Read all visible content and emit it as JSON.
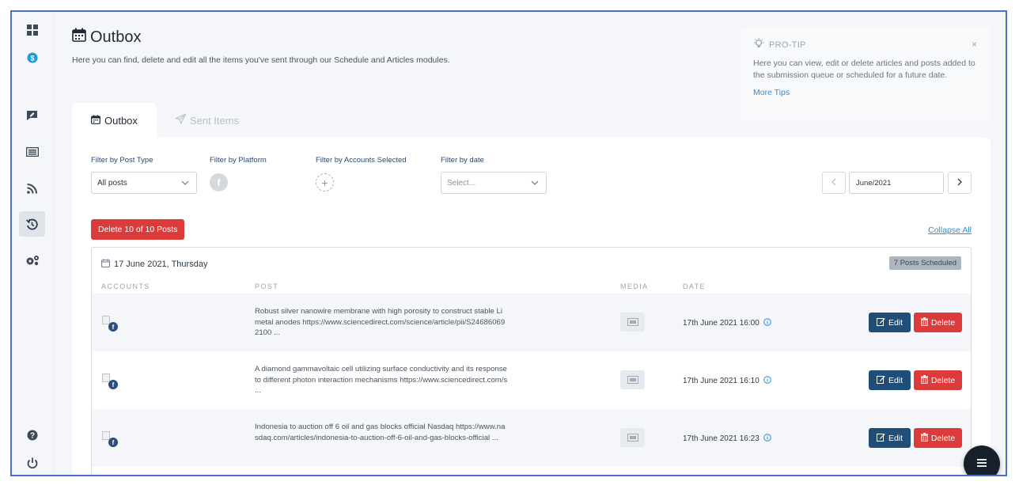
{
  "header": {
    "title": "Outbox",
    "description": "Here you can find, delete and edit all the items you've sent through our Schedule and Articles modules."
  },
  "protip": {
    "heading": "PRO-TIP",
    "close": "×",
    "text": "Here you can view, edit or delete articles and posts added to the submission queue or scheduled for a future date.",
    "link": "More Tips"
  },
  "tabs": [
    {
      "label": "Outbox",
      "active": true
    },
    {
      "label": "Sent Items",
      "active": false
    }
  ],
  "filters": {
    "post_type_label": "Filter by Post Type",
    "post_type_value": "All posts",
    "platform_label": "Filter by Platform",
    "platform_icon": "f",
    "accounts_label": "Filter by Accounts Selected",
    "accounts_add": "+",
    "date_label": "Filter by date",
    "date_placeholder": "Select...",
    "month_value": "June/2021"
  },
  "actions": {
    "delete_all": "Delete 10 of 10 Posts",
    "collapse_all": "Collapse All"
  },
  "group": {
    "date": "17 June 2021, Thursday",
    "badge": "7 Posts Scheduled",
    "columns": [
      "ACCOUNTS",
      "POST",
      "MEDIA",
      "DATE"
    ]
  },
  "rows": [
    {
      "post": "Robust silver nanowire membrane with high porosity to construct stable Li metal anodes https://www.sciencedirect.com/science/article/pii/S246860692100 ...",
      "date": "17th June 2021 16:00",
      "edit": "Edit",
      "delete": "Delete"
    },
    {
      "post": "A diamond gammavoltaic cell utilizing surface conductivity and its response to different photon interaction mechanisms https://www.sciencedirect.com/s ...",
      "date": "17th June 2021 16:10",
      "edit": "Edit",
      "delete": "Delete"
    },
    {
      "post": "Indonesia to auction off 6 oil and gas blocks official Nasdaq https://www.nasdaq.com/articles/indonesia-to-auction-off-6-oil-and-gas-blocks-official ...",
      "date": "17th June 2021 16:23",
      "edit": "Edit",
      "delete": "Delete"
    }
  ],
  "sidebar": {
    "items": [
      "dashboard-icon",
      "brand-icon",
      "compose-icon",
      "articles-icon",
      "rss-icon",
      "history-icon",
      "settings-icon",
      "help-icon",
      "power-icon"
    ],
    "active": "history-icon"
  },
  "colors": {
    "accent": "#2f8fd3",
    "danger": "#dc3b3b",
    "edit": "#1f4e79"
  }
}
